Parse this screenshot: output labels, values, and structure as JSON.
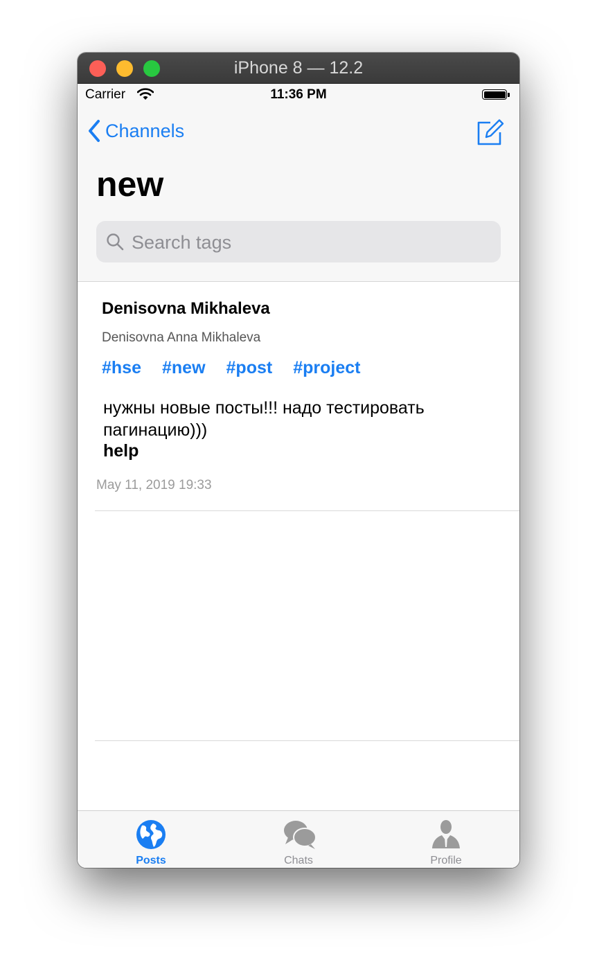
{
  "window": {
    "title": "iPhone 8 — 12.2"
  },
  "status_bar": {
    "carrier": "Carrier",
    "time": "11:36 PM"
  },
  "nav": {
    "back_label": "Channels",
    "title": "new"
  },
  "search": {
    "placeholder": "Search tags",
    "value": ""
  },
  "post": {
    "author_name": "Denisovna Mikhaleva",
    "author_full_name": "Denisovna Anna Mikhaleva",
    "tags": [
      "#hse",
      "#new",
      "#post",
      "#project"
    ],
    "text": "нужны новые посты!!! надо тестировать пагинацию)))",
    "bold_line": "help",
    "date": "May 11, 2019 19:33"
  },
  "tab_bar": {
    "items": [
      {
        "label": "Posts",
        "icon": "globe-icon",
        "selected": true
      },
      {
        "label": "Chats",
        "icon": "chat-bubbles-icon",
        "selected": false
      },
      {
        "label": "Profile",
        "icon": "person-icon",
        "selected": false
      }
    ]
  },
  "colors": {
    "accent": "#1a7ef2",
    "inactive": "#8e8e93"
  }
}
